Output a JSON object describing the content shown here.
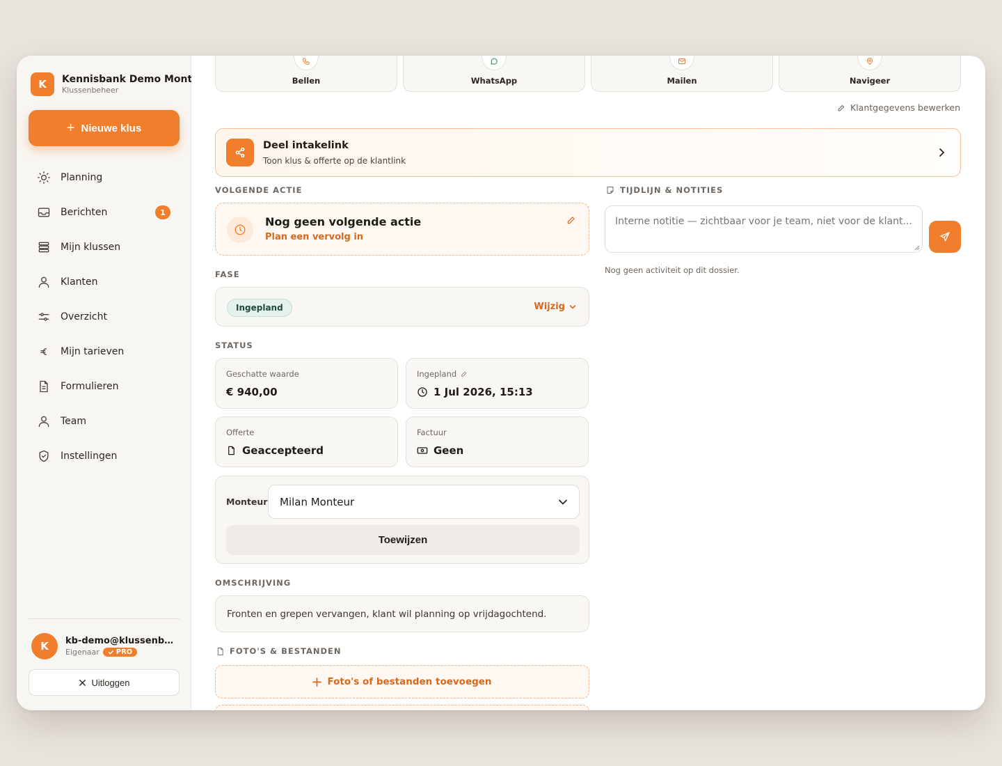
{
  "brand": {
    "name": "Kennisbank Demo Montage",
    "subtitle": "Klussenbeheer",
    "logo_letter": "K"
  },
  "sidebar": {
    "new_button": "Nieuwe klus",
    "items": [
      {
        "label": "Planning",
        "icon": "sun-icon"
      },
      {
        "label": "Berichten",
        "icon": "inbox-icon",
        "badge": "1"
      },
      {
        "label": "Mijn klussen",
        "icon": "stack-icon"
      },
      {
        "label": "Klanten",
        "icon": "user-icon"
      },
      {
        "label": "Overzicht",
        "icon": "sliders-icon"
      },
      {
        "label": "Mijn tarieven",
        "icon": "euro-icon"
      },
      {
        "label": "Formulieren",
        "icon": "document-icon"
      },
      {
        "label": "Team",
        "icon": "user-icon"
      },
      {
        "label": "Instellingen",
        "icon": "shield-icon"
      }
    ],
    "user": {
      "initial": "K",
      "email": "kb-demo@klussenbeheer.nl",
      "role": "Eigenaar",
      "badge": "PRO"
    },
    "logout": "Uitloggen"
  },
  "contact_actions": [
    {
      "label": "Bellen",
      "icon": "phone-icon"
    },
    {
      "label": "WhatsApp",
      "icon": "whatsapp-icon"
    },
    {
      "label": "Mailen",
      "icon": "mail-icon"
    },
    {
      "label": "Navigeer",
      "icon": "map-pin-icon"
    }
  ],
  "edit_client": "Klantgegevens bewerken",
  "intake": {
    "title": "Deel intakelink",
    "subtitle": "Toon klus & offerte op de klantlink"
  },
  "next_action": {
    "section": "VOLGENDE ACTIE",
    "title": "Nog geen volgende actie",
    "subtitle": "Plan een vervolg in"
  },
  "fase": {
    "section": "FASE",
    "value": "Ingepland",
    "change": "Wijzig"
  },
  "status": {
    "section": "STATUS",
    "cards": [
      {
        "label": "Geschatte waarde",
        "value": "€ 940,00",
        "icon": "euro-icon"
      },
      {
        "label": "Ingepland",
        "value": "1 Jul 2026, 15:13",
        "icon": "clock-icon"
      },
      {
        "label": "Offerte",
        "value": "Geaccepteerd",
        "icon": "document-icon"
      },
      {
        "label": "Factuur",
        "value": "Geen",
        "icon": "banknote-icon"
      }
    ]
  },
  "monteur": {
    "label": "Monteur",
    "selected": "Milan Monteur",
    "assign": "Toewijzen"
  },
  "omschrijving": {
    "section": "OMSCHRIJVING",
    "text": "Fronten en grepen vervangen, klant wil planning op vrijdagochtend."
  },
  "files": {
    "section": "FOTO'S & BESTANDEN",
    "add": "Foto's of bestanden toevoegen"
  },
  "timeline": {
    "section": "TIJDLIJN & NOTITIES",
    "placeholder": "Interne notitie — zichtbaar voor je team, niet voor de klant...",
    "empty": "Nog geen activiteit op dit dossier."
  },
  "colors": {
    "accent": "#f07e2c",
    "accent_text": "#d5691d",
    "phase_bg": "#e4f1ec"
  }
}
